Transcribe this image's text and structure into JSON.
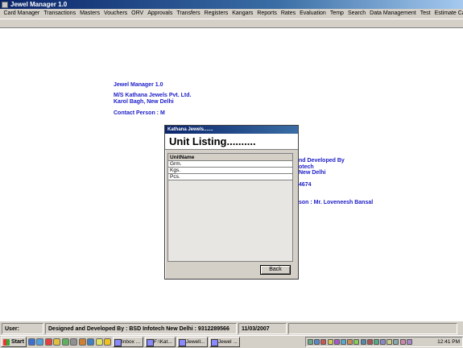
{
  "window": {
    "title": "Jewel Manager 1.0"
  },
  "menu": [
    "Card Manager",
    "Transactions",
    "Masters",
    "Vouchers",
    "ORV",
    "Approvals",
    "Transfers",
    "Registers",
    "Kangars",
    "Reports",
    "Rates",
    "Evaluation",
    "Temp",
    "Search",
    "Data Management",
    "Test",
    "Estimate Calculator"
  ],
  "background": {
    "app_name": "Jewel Manager 1.0",
    "company": "M/S Kathana Jewels Pvt. Ltd.",
    "address": "Karol Bagh, New Delhi",
    "contact": "Contact Person : M",
    "designed_by": "nd Developed By",
    "infotech": "otech",
    "new_delhi": "New Delhi",
    "phone": "4674",
    "contact2": "son : Mr. Loveneesh Bansal"
  },
  "dialog": {
    "title": "Kathana Jewels.......",
    "heading": "Unit Listing..........",
    "column_header": "UnitName",
    "rows": [
      "Grm.",
      "Kgs.",
      "Pcs."
    ],
    "back_label": "Back"
  },
  "statusbar": {
    "user": "User:",
    "designed": "Designed and Developed By : BSD Infotech New Delhi : 9312289566",
    "date": "11/03/2007"
  },
  "taskbar": {
    "start_label": "Start",
    "tasks": [
      "Inbox ...",
      "F:\\Kat...",
      "Jewell...",
      "Jewel ..."
    ],
    "clock": "12:41 PM"
  }
}
